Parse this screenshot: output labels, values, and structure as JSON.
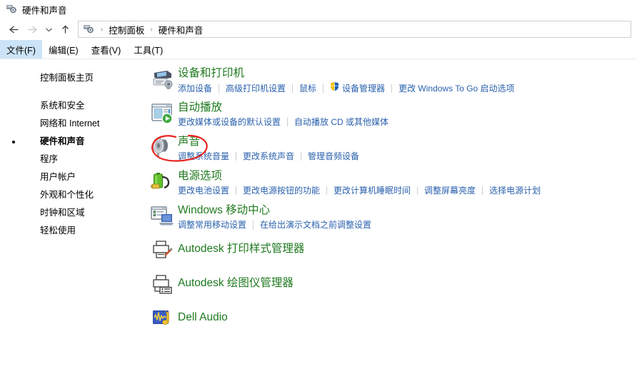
{
  "window": {
    "title": "硬件和声音",
    "title_icon": "hardware-and-sound-icon"
  },
  "navbar": {
    "back_icon": "back-arrow-icon",
    "forward_icon": "forward-arrow-icon",
    "recent_icon": "chevron-down-icon",
    "up_icon": "up-arrow-icon",
    "address_icon": "hardware-and-sound-icon",
    "breadcrumbs": [
      "控制面板",
      "硬件和声音"
    ],
    "separator": "›"
  },
  "menubar": {
    "items": [
      {
        "label": "文件(F)",
        "active": true
      },
      {
        "label": "编辑(E)",
        "active": false
      },
      {
        "label": "查看(V)",
        "active": false
      },
      {
        "label": "工具(T)",
        "active": false
      }
    ]
  },
  "sidebar": {
    "home": "控制面板主页",
    "items": [
      {
        "label": "系统和安全",
        "current": false
      },
      {
        "label": "网络和 Internet",
        "current": false
      },
      {
        "label": "硬件和声音",
        "current": true
      },
      {
        "label": "程序",
        "current": false
      },
      {
        "label": "用户帐户",
        "current": false
      },
      {
        "label": "外观和个性化",
        "current": false
      },
      {
        "label": "时钟和区域",
        "current": false
      },
      {
        "label": "轻松使用",
        "current": false
      }
    ]
  },
  "categories": [
    {
      "id": "devices-and-printers",
      "icon": "printer-device-icon",
      "title": "设备和打印机",
      "links": [
        {
          "label": "添加设备",
          "shield": false
        },
        {
          "label": "高级打印机设置",
          "shield": false
        },
        {
          "label": "鼠标",
          "shield": false
        },
        {
          "label": "设备管理器",
          "shield": true
        },
        {
          "label": "更改 Windows To Go 启动选项",
          "shield": false
        }
      ]
    },
    {
      "id": "autoplay",
      "icon": "autoplay-icon",
      "title": "自动播放",
      "links": [
        {
          "label": "更改媒体或设备的默认设置",
          "shield": false
        },
        {
          "label": "自动播放 CD 或其他媒体",
          "shield": false
        }
      ]
    },
    {
      "id": "sound",
      "icon": "speaker-icon",
      "title": "声音",
      "links": [
        {
          "label": "调整系统音量",
          "shield": false
        },
        {
          "label": "更改系统声音",
          "shield": false
        },
        {
          "label": "管理音频设备",
          "shield": false
        }
      ]
    },
    {
      "id": "power-options",
      "icon": "battery-power-icon",
      "title": "电源选项",
      "links": [
        {
          "label": "更改电池设置",
          "shield": false
        },
        {
          "label": "更改电源按钮的功能",
          "shield": false
        },
        {
          "label": "更改计算机睡眠时间",
          "shield": false
        },
        {
          "label": "调整屏幕亮度",
          "shield": false
        },
        {
          "label": "选择电源计划",
          "shield": false
        }
      ]
    },
    {
      "id": "windows-mobility-center",
      "icon": "mobility-center-icon",
      "title": "Windows 移动中心",
      "links": [
        {
          "label": "调整常用移动设置",
          "shield": false
        },
        {
          "label": "在给出演示文档之前调整设置",
          "shield": false
        }
      ]
    },
    {
      "id": "autodesk-plot-style-manager",
      "icon": "printer-brush-icon",
      "title": "Autodesk 打印样式管理器",
      "links": []
    },
    {
      "id": "autodesk-plotter-manager",
      "icon": "printer-list-icon",
      "title": "Autodesk 绘图仪管理器",
      "links": []
    },
    {
      "id": "dell-audio",
      "icon": "dell-audio-icon",
      "title": "Dell Audio",
      "links": []
    }
  ],
  "annotation": {
    "name": "red-circle-highlight",
    "target": "sound",
    "color": "#e8241f"
  },
  "colors": {
    "heading_green": "#1f7a1f",
    "link_blue": "#2a61ad",
    "menu_highlight": "#cce4f7",
    "annotation_red": "#e8241f"
  }
}
